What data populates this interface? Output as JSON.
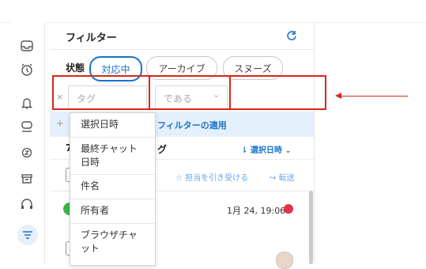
{
  "panel": {
    "title": "フィルター",
    "status_label": "状態",
    "status_chips": [
      "対応中",
      "アーカイブ",
      "スヌーズ"
    ],
    "filter_row": {
      "remove": "×",
      "field_placeholder": "タグ",
      "operator_placeholder": "である",
      "operator_caret": "⌄"
    },
    "add": "+",
    "apply_label": "フィルターの適用",
    "sort_row_left": "7",
    "sort_row_text": "グ",
    "sort_label": "選択日時",
    "sort_prefix": "⇂",
    "sort_caret": "⌄",
    "action_assign": "担当を引き受ける",
    "action_assign_icon": "☆",
    "action_transfer": "転送",
    "action_transfer_icon": "↪",
    "item_date": "1月 24, 19:06"
  },
  "dropdown": {
    "items": [
      "選択日時",
      "最終チャット日時",
      "件名",
      "所有者",
      "ブラウザチャット"
    ]
  },
  "colors": {
    "accent": "#1a73c9",
    "highlight": "#d9261c",
    "apply_bg": "#e4f0fb",
    "online": "#3bb54a",
    "alert": "#e0334a"
  },
  "icons": [
    "inbox-icon",
    "alarm-icon",
    "bell-icon",
    "chat-icon",
    "snooze-icon",
    "archive-icon",
    "support-icon",
    "filter-icon",
    "refresh-icon"
  ]
}
